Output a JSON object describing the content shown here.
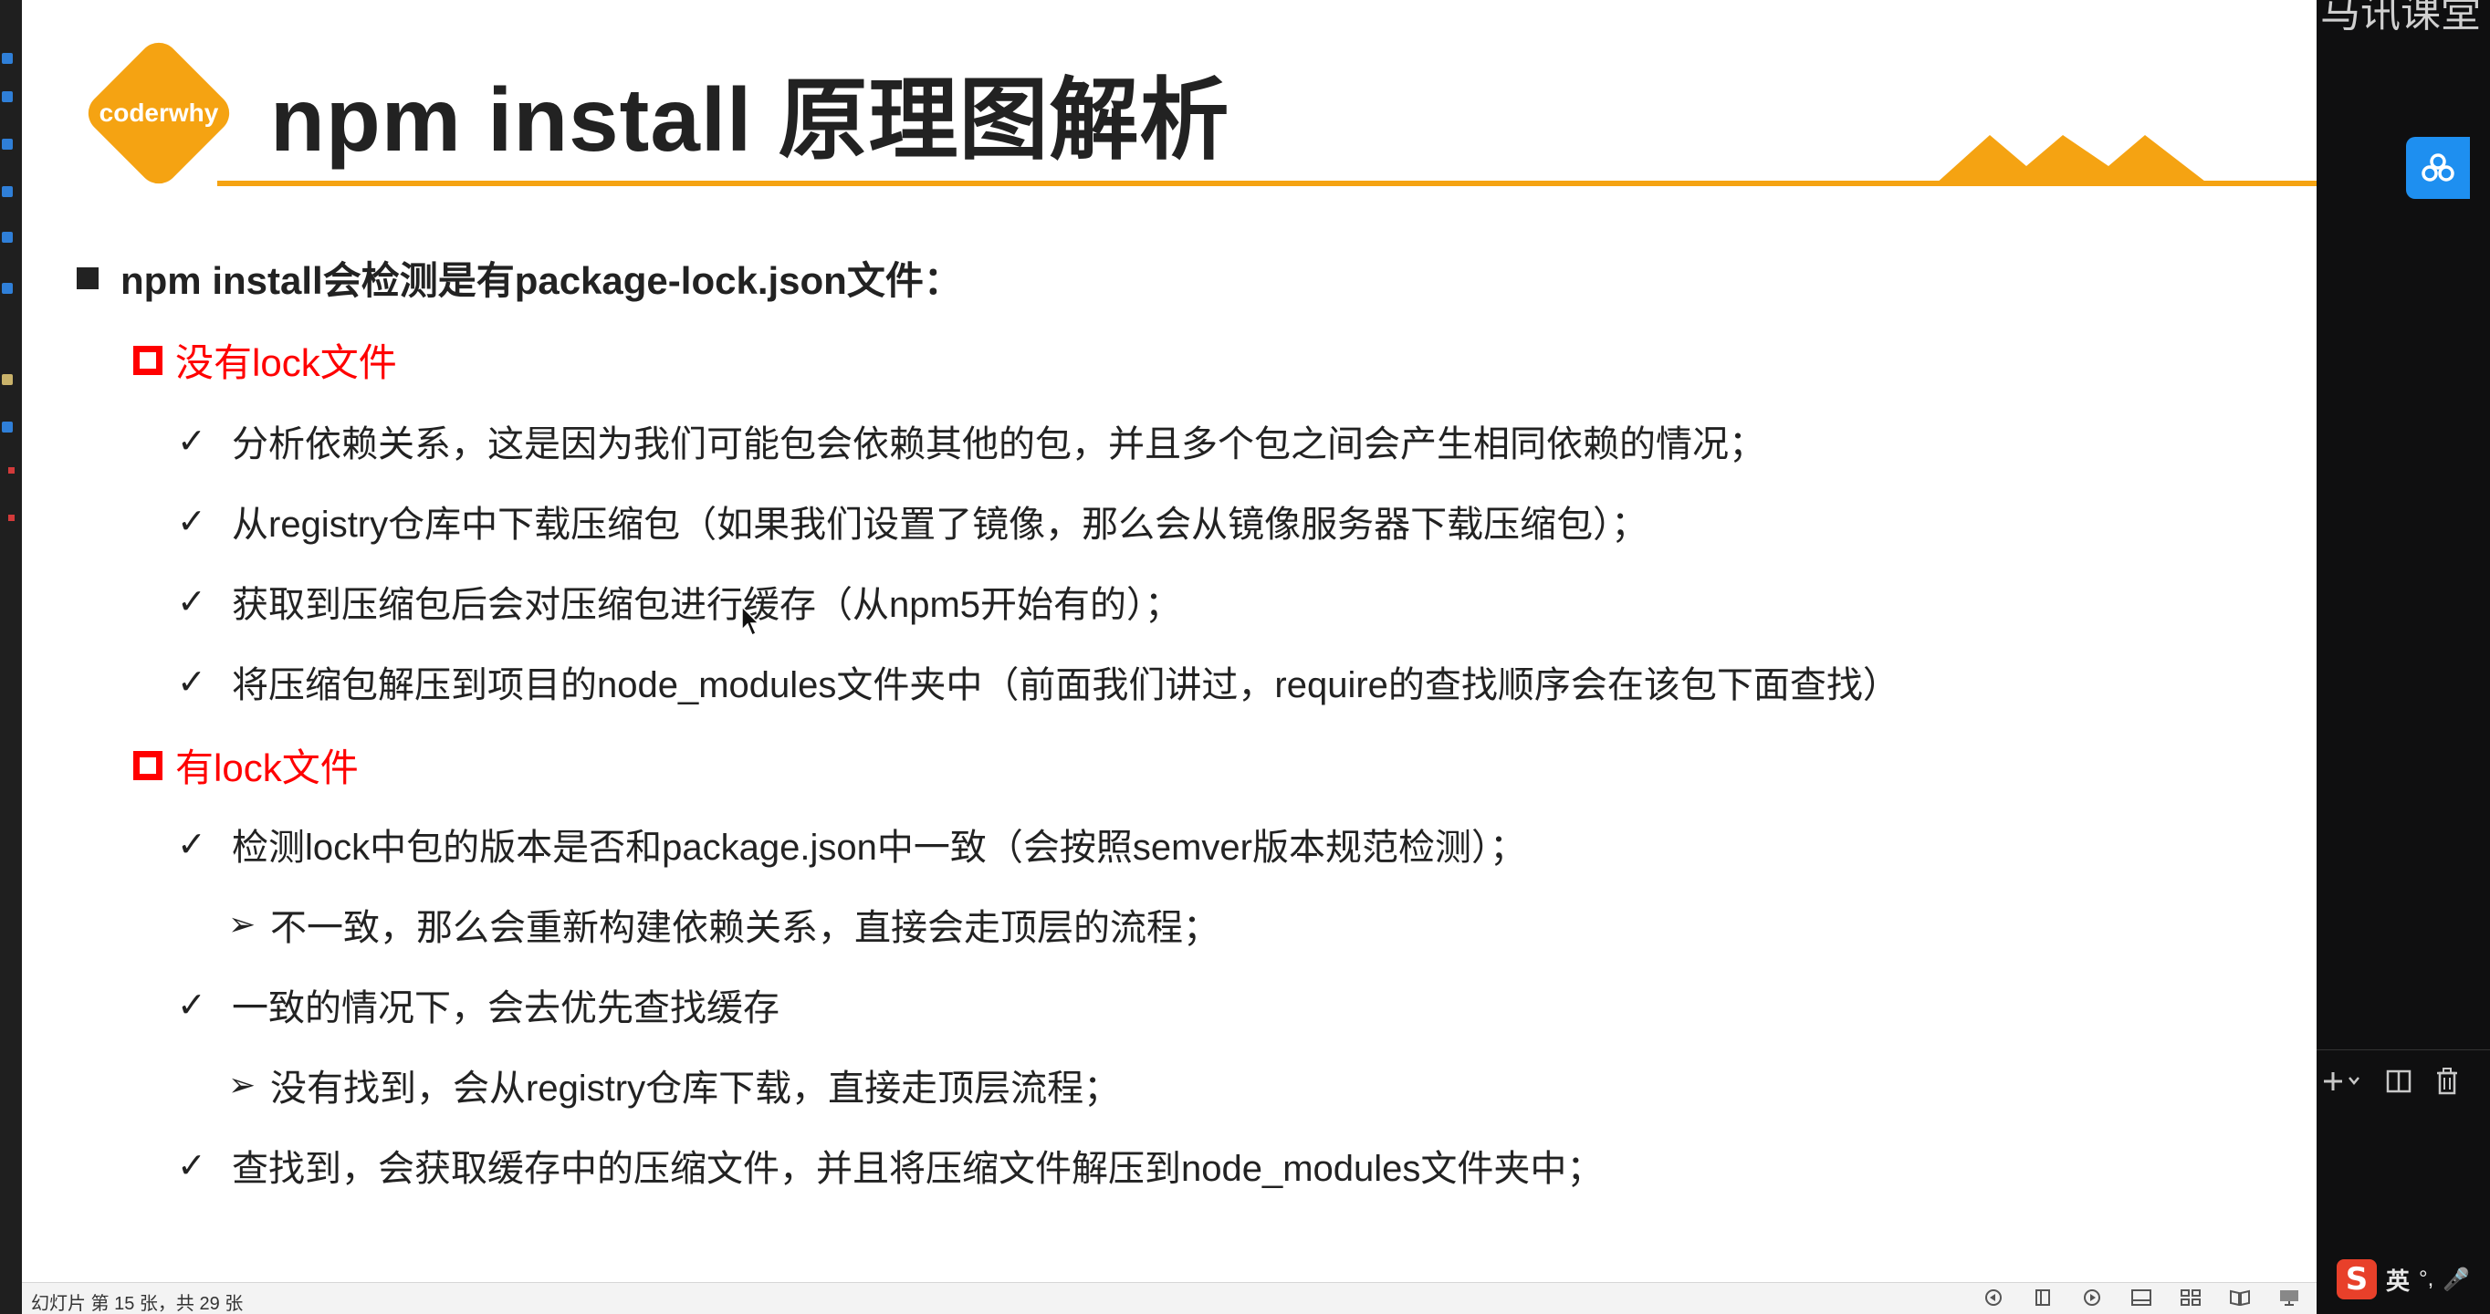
{
  "slide": {
    "logo_text": "coderwhy",
    "title": "npm install 原理图解析",
    "main_bullet": "npm install会检测是有package-lock.json文件：",
    "sections": [
      {
        "heading": "没有lock文件",
        "items": [
          {
            "type": "check",
            "text": "分析依赖关系，这是因为我们可能包会依赖其他的包，并且多个包之间会产生相同依赖的情况；"
          },
          {
            "type": "check",
            "text": "从registry仓库中下载压缩包（如果我们设置了镜像，那么会从镜像服务器下载压缩包）；"
          },
          {
            "type": "check",
            "text": "获取到压缩包后会对压缩包进行缓存（从npm5开始有的）；"
          },
          {
            "type": "check",
            "text": "将压缩包解压到项目的node_modules文件夹中（前面我们讲过，require的查找顺序会在该包下面查找）"
          }
        ]
      },
      {
        "heading": "有lock文件",
        "items": [
          {
            "type": "check",
            "text": "检测lock中包的版本是否和package.json中一致（会按照semver版本规范检测）；"
          },
          {
            "type": "arrow",
            "text": "不一致，那么会重新构建依赖关系，直接会走顶层的流程；"
          },
          {
            "type": "check",
            "text": "一致的情况下，会去优先查找缓存"
          },
          {
            "type": "arrow",
            "text": "没有找到，会从registry仓库下载，直接走顶层流程；"
          },
          {
            "type": "check",
            "text": "查找到，会获取缓存中的压缩文件，并且将压缩文件解压到node_modules文件夹中；"
          }
        ]
      }
    ],
    "marks": {
      "check": "✓",
      "arrow": "➢"
    }
  },
  "status_bar": {
    "slide_info": "幻灯片 第 15 张，共 29 张"
  },
  "right_panel": {
    "top_text": "马讯课堂"
  },
  "ime": {
    "lang": "英",
    "punct": "°,",
    "mic": "🎤"
  },
  "colors": {
    "accent": "#f5a312",
    "red_heading": "#ff0000",
    "cloud_button": "#1e8ff0"
  },
  "icons": [
    "cloud-icon",
    "plus-icon",
    "chevron-down-icon",
    "split-icon",
    "trash-icon",
    "sogou-ime-icon"
  ]
}
